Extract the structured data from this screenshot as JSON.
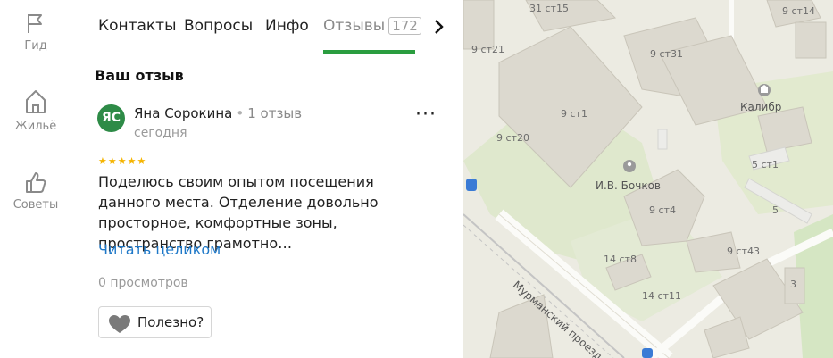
{
  "rail": {
    "items": [
      {
        "label": "Гид",
        "icon": "flag-icon"
      },
      {
        "label": "Жильё",
        "icon": "building-icon"
      },
      {
        "label": "Советы",
        "icon": "thumb-up-icon"
      }
    ]
  },
  "tabs": {
    "items": [
      "Контакты",
      "Вопросы",
      "Инфо",
      "Отзывы"
    ],
    "reviews_count": "172",
    "active": "Отзывы"
  },
  "review": {
    "section_title": "Ваш отзыв",
    "avatar_initials": "ЯС",
    "author": "Яна Сорокина",
    "author_reviews": "1 отзыв",
    "date": "сегодня",
    "rating": "★★★★★",
    "text": "Поделюсь своим опытом посещения данного места. Отделение довольно просторное, комфортные зоны, пространство грамотно…",
    "read_more": "Читать целиком",
    "views": "0 просмотров",
    "useful_label": "Полезно?"
  },
  "map": {
    "labels": {
      "l1": "31 ст15",
      "l2": "9 ст14",
      "l3": "9 ст21",
      "l4": "9 ст31",
      "l5": "Калибр",
      "l6": "9 ст1",
      "l7": "9 ст20",
      "l8": "5 ст1",
      "l9": "И.В. Бочков",
      "l10": "9 ст4",
      "l11": "5",
      "l12": "9 ст43",
      "l13": "14 ст8",
      "l14": "14 ст11",
      "l15": "3"
    },
    "street": "Мурманский проезд",
    "colors": {
      "accent": "#2a9d3f",
      "link": "#1e78c8",
      "star": "#f5b400",
      "avatar": "#2e8b47"
    }
  }
}
